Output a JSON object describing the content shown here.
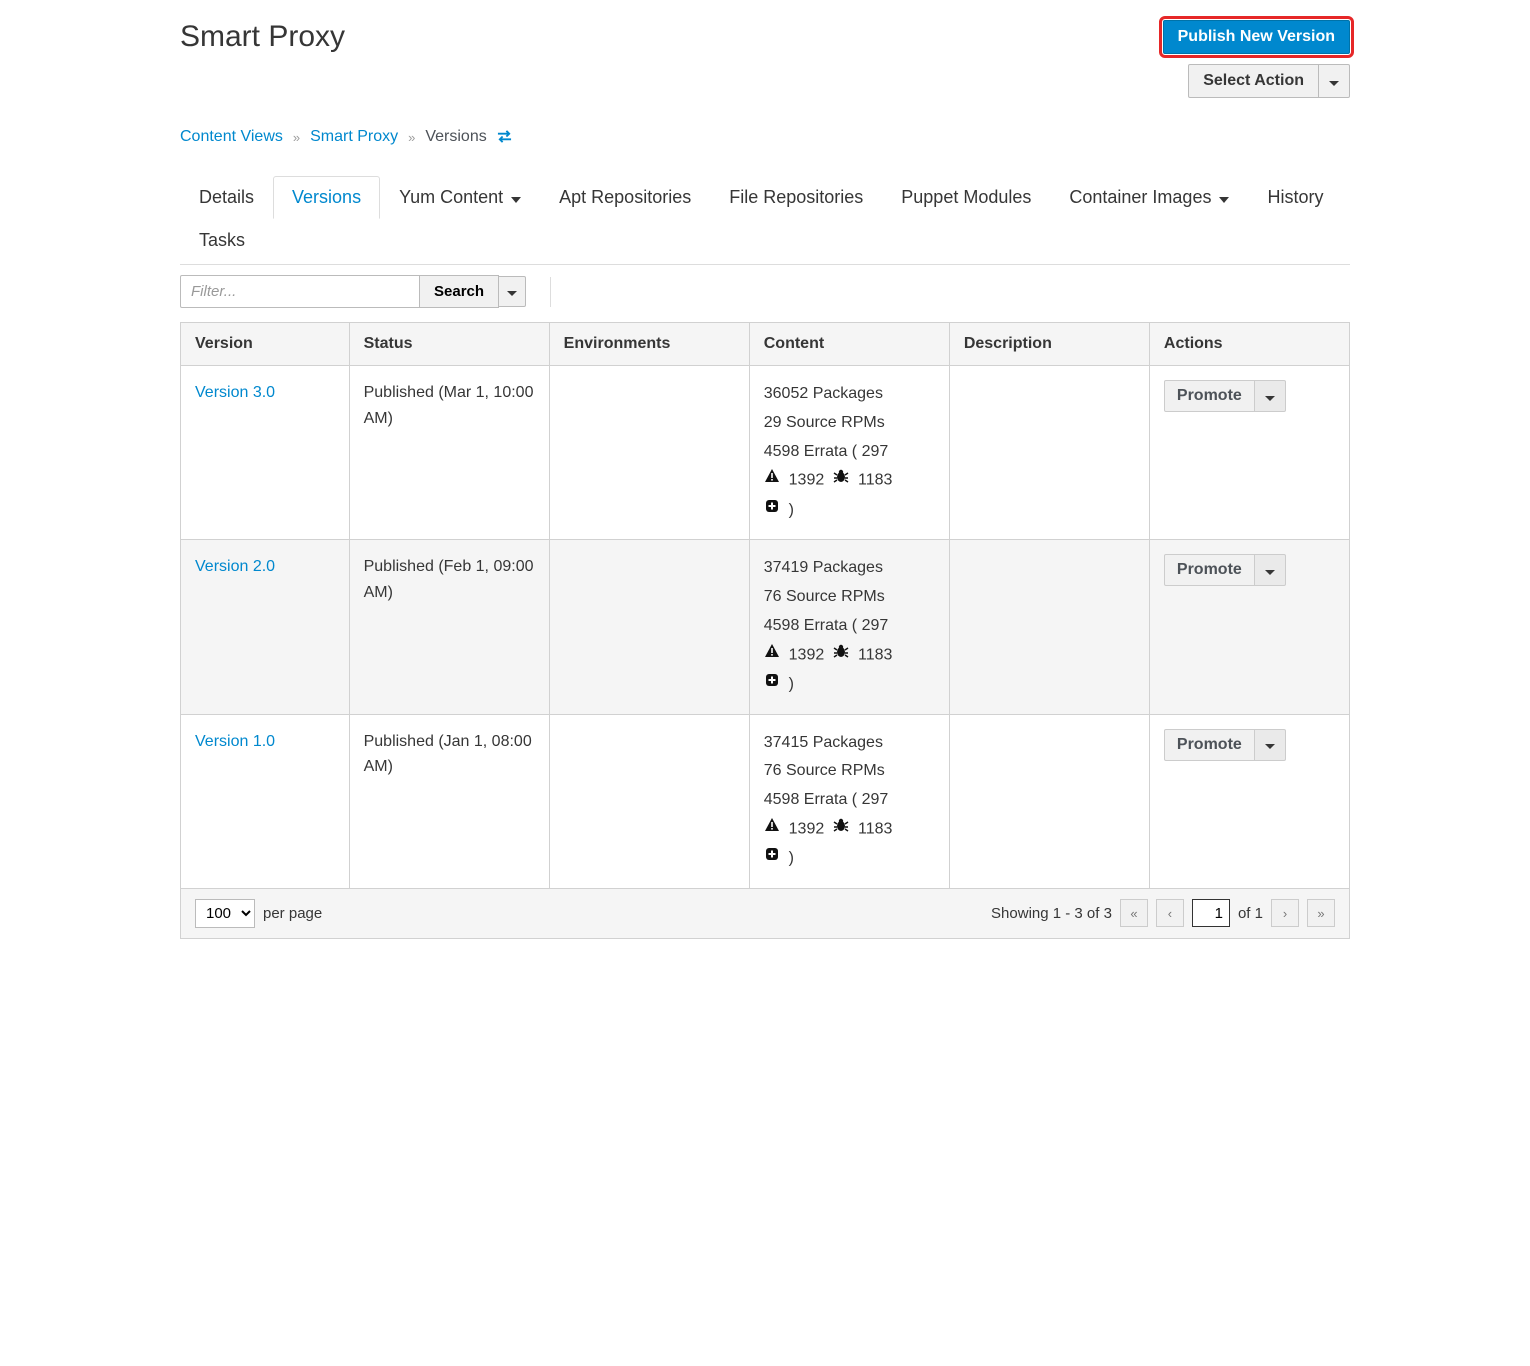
{
  "header": {
    "title": "Smart Proxy",
    "publish_btn": "Publish New Version",
    "select_action": "Select Action"
  },
  "breadcrumb": {
    "content_views": "Content Views",
    "smart_proxy": "Smart Proxy",
    "versions": "Versions"
  },
  "tabs": {
    "details": "Details",
    "versions": "Versions",
    "yum_content": "Yum Content",
    "apt_repos": "Apt Repositories",
    "file_repos": "File Repositories",
    "puppet": "Puppet Modules",
    "container": "Container Images",
    "history": "History",
    "tasks": "Tasks"
  },
  "toolbar": {
    "filter_placeholder": "Filter...",
    "search": "Search"
  },
  "table": {
    "headers": {
      "version": "Version",
      "status": "Status",
      "environments": "Environments",
      "content": "Content",
      "description": "Description",
      "actions": "Actions"
    },
    "rows": [
      {
        "version": "Version 3.0",
        "status": "Published (Mar 1, 10:00 AM)",
        "packages": "36052 Packages",
        "srpms": "29 Source RPMs",
        "errata_prefix": "4598 Errata ( 297",
        "sec": "1392",
        "bug": "1183",
        "close": ")",
        "promote": "Promote"
      },
      {
        "version": "Version 2.0",
        "status": "Published (Feb 1, 09:00 AM)",
        "packages": "37419 Packages",
        "srpms": "76 Source RPMs",
        "errata_prefix": "4598 Errata ( 297",
        "sec": "1392",
        "bug": "1183",
        "close": ")",
        "promote": "Promote"
      },
      {
        "version": "Version 1.0",
        "status": "Published (Jan 1, 08:00 AM)",
        "packages": "37415 Packages",
        "srpms": "76 Source RPMs",
        "errata_prefix": "4598 Errata ( 297",
        "sec": "1392",
        "bug": "1183",
        "close": ")",
        "promote": "Promote"
      }
    ]
  },
  "footer": {
    "per_page_value": "100",
    "per_page_label": "per page",
    "showing": "Showing 1 - 3 of 3",
    "page_current": "1",
    "of_label": "of 1"
  }
}
